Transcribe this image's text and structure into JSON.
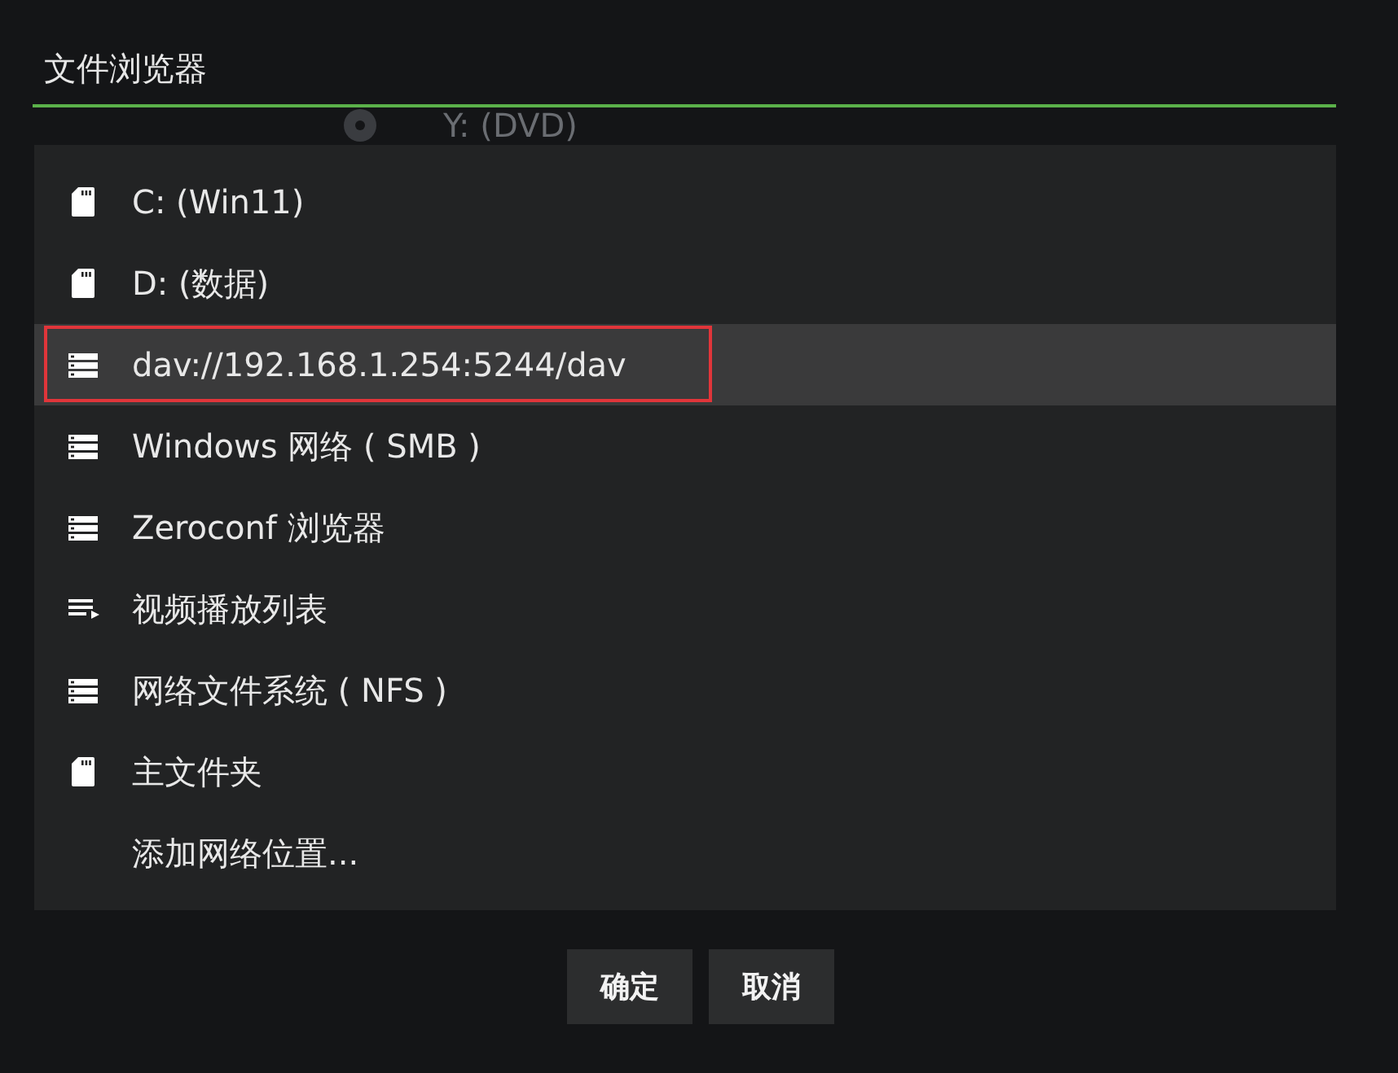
{
  "window": {
    "title": "文件浏览器"
  },
  "background_item": {
    "label": "Y: (DVD)",
    "kind": "disc"
  },
  "items": [
    {
      "label": "C: (Win11)",
      "kind": "drive",
      "selected": false,
      "annotated": false
    },
    {
      "label": "D: (数据)",
      "kind": "drive",
      "selected": false,
      "annotated": false
    },
    {
      "label": "dav://192.168.1.254:5244/dav",
      "kind": "network",
      "selected": true,
      "annotated": true
    },
    {
      "label": "Windows 网络 ( SMB )",
      "kind": "network",
      "selected": false,
      "annotated": false
    },
    {
      "label": "Zeroconf 浏览器",
      "kind": "network",
      "selected": false,
      "annotated": false
    },
    {
      "label": "视频播放列表",
      "kind": "playlist",
      "selected": false,
      "annotated": false
    },
    {
      "label": "网络文件系统 ( NFS )",
      "kind": "network",
      "selected": false,
      "annotated": false
    },
    {
      "label": "主文件夹",
      "kind": "drive",
      "selected": false,
      "annotated": false
    },
    {
      "label": "添加网络位置...",
      "kind": "none",
      "selected": false,
      "annotated": false
    }
  ],
  "buttons": [
    "确定",
    "取消"
  ]
}
